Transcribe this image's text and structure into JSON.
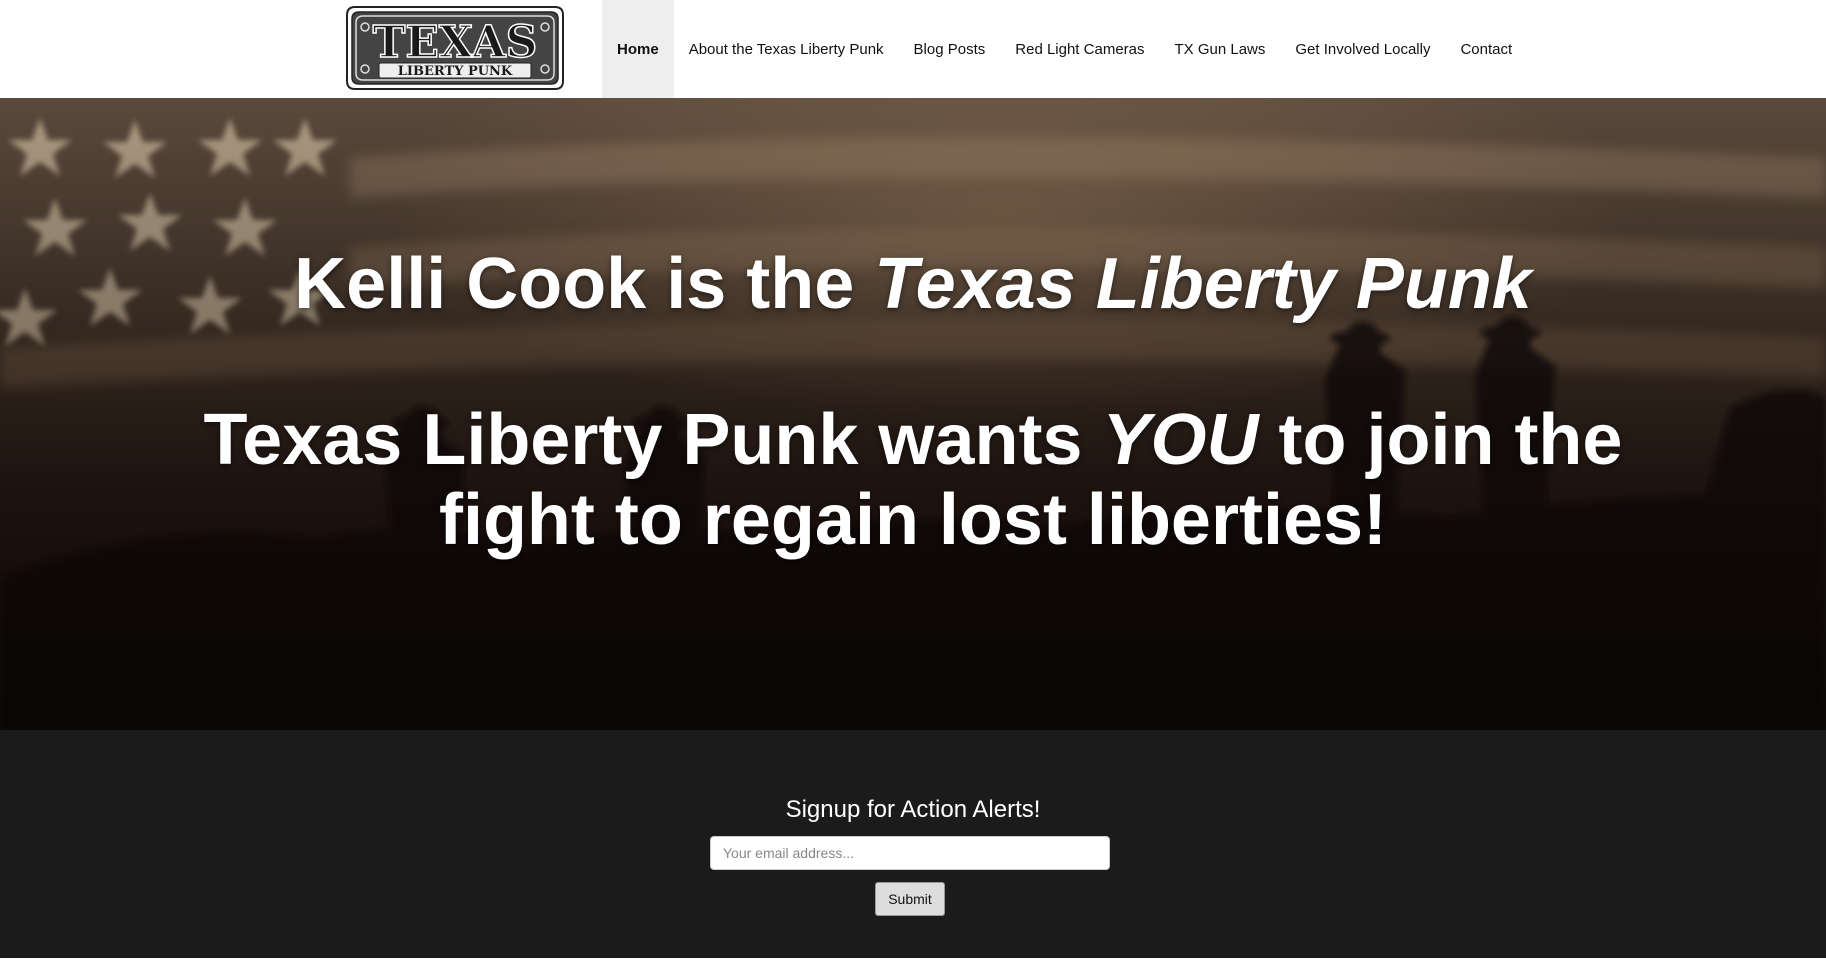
{
  "logo": {
    "line1": "TEXAS",
    "line2": "LIBERTY PUNK"
  },
  "nav": {
    "items": [
      {
        "label": "Home",
        "active": true
      },
      {
        "label": "About the Texas Liberty Punk",
        "active": false
      },
      {
        "label": "Blog Posts",
        "active": false
      },
      {
        "label": "Red Light Cameras",
        "active": false
      },
      {
        "label": "TX Gun Laws",
        "active": false
      },
      {
        "label": "Get Involved Locally",
        "active": false
      },
      {
        "label": "Contact",
        "active": false
      }
    ]
  },
  "hero": {
    "line1_plain": "Kelli Cook is the ",
    "line1_italic": "Texas Liberty Punk",
    "line2_plain_a": "Texas Liberty Punk wants ",
    "line2_italic": "YOU",
    "line2_plain_b": " to join the fight to regain lost liberties!"
  },
  "signup": {
    "title": "Signup for Action Alerts!",
    "email_placeholder": "Your email address...",
    "email_value": "",
    "submit_label": "Submit"
  },
  "colors": {
    "header_bg": "#ffffff",
    "active_nav_bg": "#eeeeee",
    "signup_bg": "#1b1b1b",
    "hero_text": "#ffffff"
  }
}
